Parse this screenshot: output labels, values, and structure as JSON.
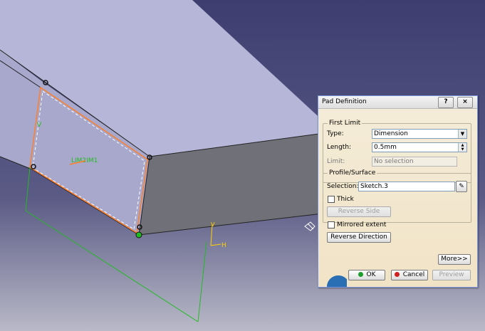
{
  "dialog": {
    "title": "Pad Definition",
    "help_button": "?",
    "close_button": "×",
    "first_limit": {
      "group_label": "First Limit",
      "type_label": "Type:",
      "type_value": "Dimension",
      "length_label": "Length:",
      "length_value": "0.5mm",
      "limit_label": "Limit:",
      "limit_value": "No selection"
    },
    "profile": {
      "group_label": "Profile/Surface",
      "selection_label": "Selection:",
      "selection_value": "Sketch.3",
      "thick_label": "Thick",
      "thick_checked": false,
      "reverse_side_label": "Reverse Side"
    },
    "mirrored_label": "Mirrored extent",
    "mirrored_checked": false,
    "reverse_direction_label": "Reverse Direction",
    "more_label": "More>>",
    "ok_label": "OK",
    "cancel_label": "Cancel",
    "preview_label": "Preview"
  },
  "scene": {
    "sketch_label": "LIM2IM1",
    "axis_v": "V",
    "axis_h": "H",
    "background_color": "#3a3a6a",
    "sketch_color": "#ff7f2a",
    "axis_color": "#22bb22",
    "solid_face_color": "#b8b8d6",
    "solid_side_color": "#6e6e78"
  }
}
